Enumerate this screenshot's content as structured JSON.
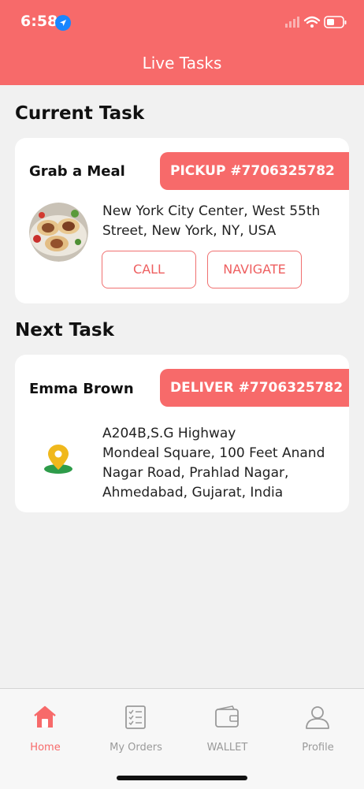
{
  "status_bar": {
    "time": "6:58"
  },
  "header": {
    "title": "Live Tasks"
  },
  "current": {
    "section_title": "Current Task",
    "name": "Grab a Meal",
    "tag": "PICKUP #7706325782",
    "address_line1": "New York City Center, West 55th",
    "address_line2": "Street, New York, NY, USA",
    "call_label": "CALL",
    "navigate_label": "NAVIGATE"
  },
  "next": {
    "section_title": "Next Task",
    "name": "Emma Brown",
    "tag": "DELIVER #7706325782",
    "address_lines": [
      "A204B,S.G Highway",
      "Mondeal Square, 100 Feet Anand",
      "Nagar Road, Prahlad Nagar,",
      "Ahmedabad, Gujarat, India"
    ]
  },
  "tabs": [
    {
      "label": "Home",
      "icon": "home-icon",
      "active": true
    },
    {
      "label": "My Orders",
      "icon": "orders-list-icon",
      "active": false
    },
    {
      "label": "WALLET",
      "icon": "wallet-icon",
      "active": false
    },
    {
      "label": "Profile",
      "icon": "profile-icon",
      "active": false
    }
  ],
  "colors": {
    "accent": "#f76a6a",
    "inactive": "#9a9a9a",
    "background": "#f1f1f1"
  }
}
